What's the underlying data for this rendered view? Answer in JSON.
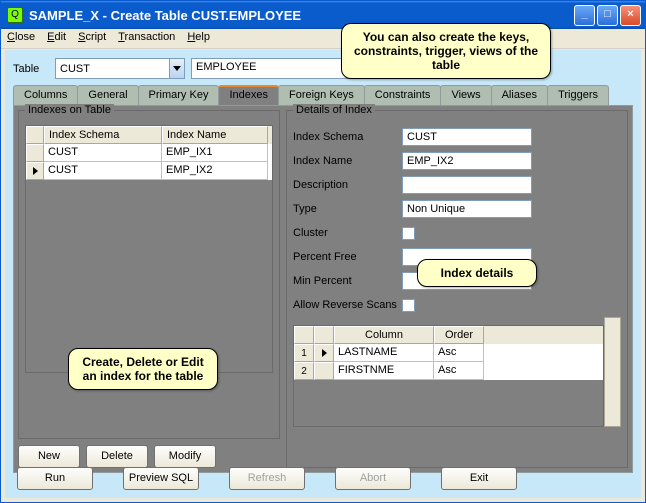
{
  "window": {
    "title": "SAMPLE_X - Create Table CUST.EMPLOYEE"
  },
  "menu": {
    "close": "Close",
    "edit": "Edit",
    "script": "Script",
    "transaction": "Transaction",
    "help": "Help"
  },
  "tablebar": {
    "label": "Table",
    "schema": "CUST",
    "name": "EMPLOYEE"
  },
  "tabs": {
    "columns": "Columns",
    "general": "General",
    "primary": "Primary Key",
    "indexes": "Indexes",
    "foreign": "Foreign Keys",
    "constraints": "Constraints",
    "views": "Views",
    "aliases": "Aliases",
    "triggers": "Triggers"
  },
  "left": {
    "group": "Indexes on Table",
    "hdr_schema": "Index Schema",
    "hdr_name": "Index Name",
    "rows": [
      {
        "schema": "CUST",
        "name": "EMP_IX1"
      },
      {
        "schema": "CUST",
        "name": "EMP_IX2"
      }
    ],
    "btn_new": "New",
    "btn_delete": "Delete",
    "btn_modify": "Modify"
  },
  "right": {
    "group": "Details of Index",
    "lbl_schema": "Index Schema",
    "val_schema": "CUST",
    "lbl_name": "Index Name",
    "val_name": "EMP_IX2",
    "lbl_desc": "Description",
    "val_desc": "",
    "lbl_type": "Type",
    "val_type": "Non Unique",
    "lbl_cluster": "Cluster",
    "lbl_pct": "Percent Free",
    "val_pct": "",
    "lbl_min": "Min Percent",
    "val_min": "",
    "lbl_rev": "Allow Reverse Scans",
    "col_hdr_col": "Column",
    "col_hdr_ord": "Order",
    "cols": [
      {
        "n": "1",
        "col": "LASTNAME",
        "ord": "Asc"
      },
      {
        "n": "2",
        "col": "FIRSTNME",
        "ord": "Asc"
      }
    ]
  },
  "callouts": {
    "top": "You can also create the keys, constraints, trigger, views of the table",
    "left": "Create, Delete or Edit an index for the table",
    "right": "Index details"
  },
  "bottom": {
    "run": "Run",
    "preview": "Preview SQL",
    "refresh": "Refresh",
    "abort": "Abort",
    "exit": "Exit"
  }
}
